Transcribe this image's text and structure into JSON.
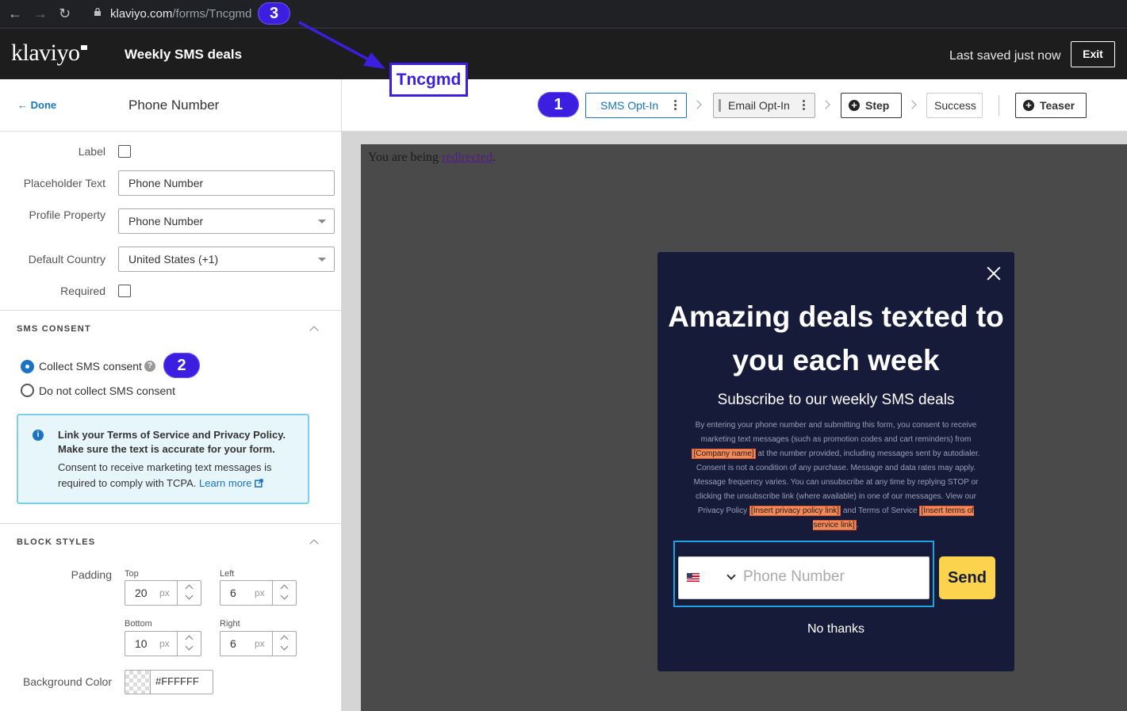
{
  "browser": {
    "url_host": "klaviyo.com",
    "url_path": "/forms/Tncgmd"
  },
  "annotations": {
    "badge_1": "1",
    "badge_2": "2",
    "badge_3": "3",
    "callout": "Tncgmd",
    "accent_color": "#3b1ee0"
  },
  "header": {
    "logo": "klaviyo",
    "form_title": "Weekly SMS deals",
    "saved_status": "Last saved just now",
    "exit_label": "Exit"
  },
  "left_panel": {
    "done_label": "Done",
    "title": "Phone Number",
    "fields": {
      "label_label": "Label",
      "placeholder_label": "Placeholder Text",
      "placeholder_value": "Phone Number",
      "profile_label": "Profile Property",
      "profile_value": "Phone Number",
      "country_label": "Default Country",
      "country_value": "United States (+1)",
      "required_label": "Required"
    },
    "sms_consent": {
      "title": "SMS CONSENT",
      "collect_label": "Collect SMS consent",
      "not_collect_label": "Do not collect SMS consent",
      "selected": "collect",
      "info_bold": "Link your Terms of Service and Privacy Policy. Make sure the text is accurate for your form.",
      "info_text": "Consent to receive marketing text messages is required to comply with TCPA.",
      "info_link": "Learn more"
    },
    "block_styles": {
      "title": "BLOCK STYLES",
      "padding_label": "Padding",
      "top_label": "Top",
      "top_value": "20",
      "left_label": "Left",
      "left_value": "6",
      "bottom_label": "Bottom",
      "bottom_value": "10",
      "right_label": "Right",
      "right_value": "6",
      "unit": "px",
      "bg_label": "Background Color",
      "bg_value": "#FFFFFF"
    }
  },
  "steps": {
    "sms_optin": "SMS Opt-In",
    "email_optin": "Email Opt-In",
    "step": "Step",
    "success": "Success",
    "teaser": "Teaser"
  },
  "canvas": {
    "redirect_prefix": "You are being ",
    "redirect_link": "redirected",
    "redirect_suffix": "."
  },
  "popup": {
    "headline": "Amazing deals texted to you each week",
    "subhead": "Subscribe to our weekly SMS deals",
    "legal_1": "By entering your phone number and submitting this form, you consent to receive marketing text messages (such as promotion codes and cart reminders) from ",
    "legal_company": "[Company name]",
    "legal_2": " at the number provided, including messages sent by autodialer. Consent is not a condition of any purchase. Message and data rates may apply. Message frequency varies. You can unsubscribe at any time by replying STOP or clicking the unsubscribe link (where available) in one of our messages. View our Privacy Policy ",
    "legal_privacy": "[Insert privacy policy link]",
    "legal_3": " and Terms of Service ",
    "legal_terms": "[Insert terms of service link]",
    "legal_4": ".",
    "phone_placeholder": "Phone Number",
    "send_label": "Send",
    "no_thanks": "No thanks",
    "bg_color": "#161b3a",
    "send_color": "#fbd34d"
  }
}
